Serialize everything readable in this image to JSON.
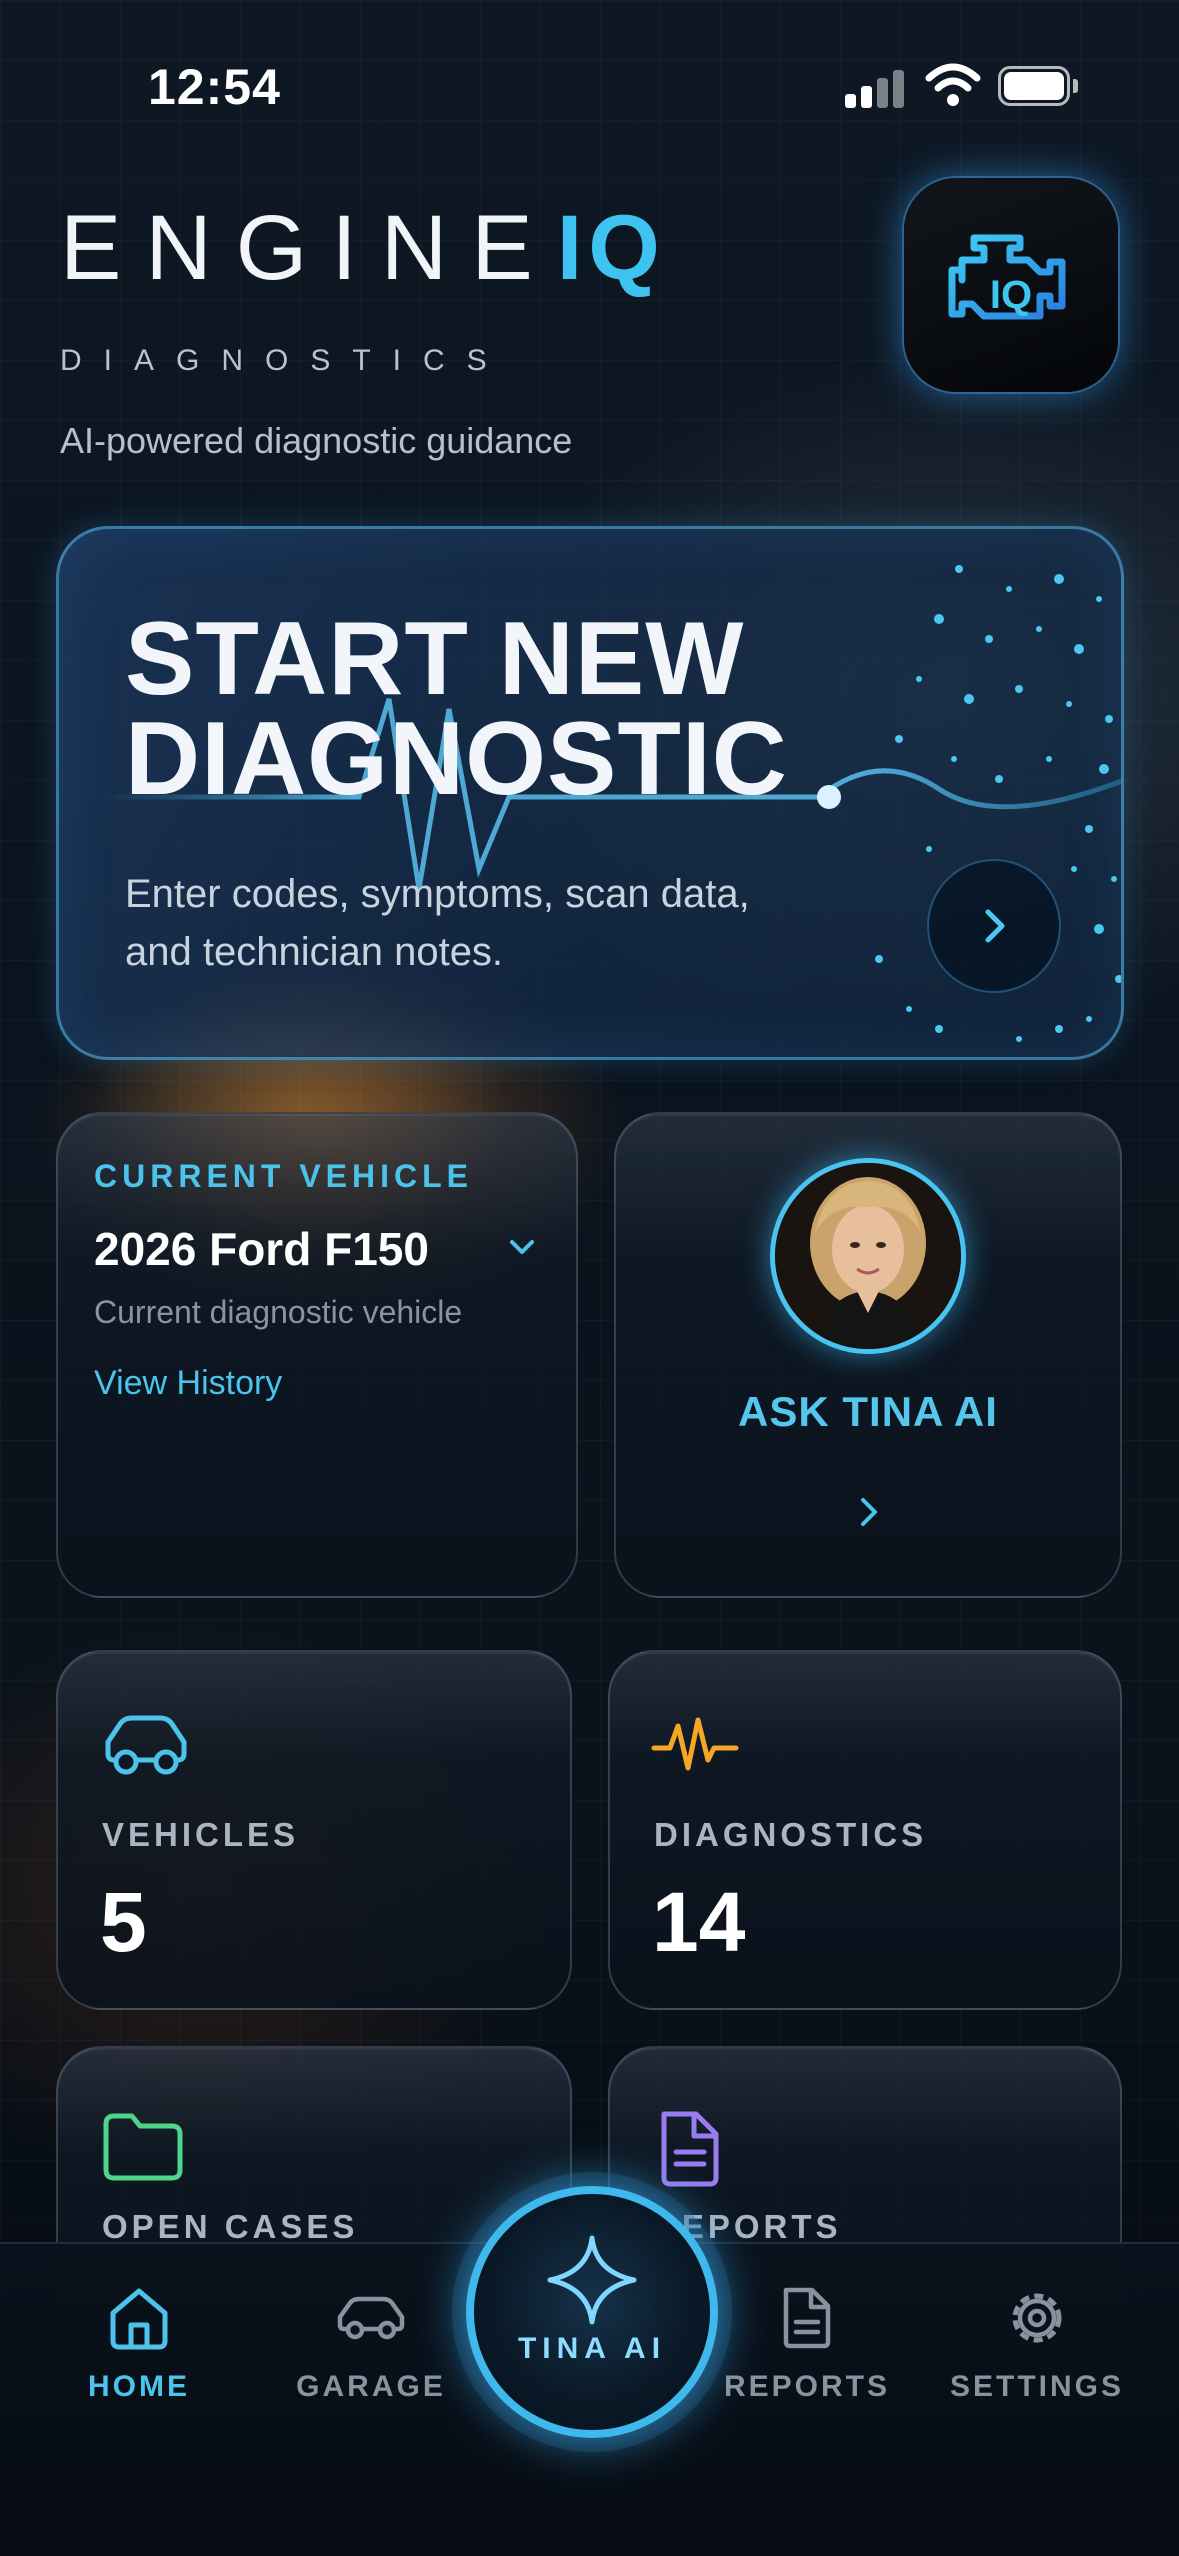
{
  "status_bar": {
    "time": "12:54"
  },
  "header": {
    "brand_main": "ENGINE",
    "brand_accent": "IQ",
    "brand_sub": "DIAGNOSTICS",
    "tagline": "AI-powered diagnostic guidance",
    "app_icon_text": "IQ"
  },
  "hero": {
    "title_line1": "START NEW",
    "title_line2": "DIAGNOSTIC",
    "description": "Enter codes, symptoms, scan data, and technician notes."
  },
  "current_vehicle": {
    "label": "CURRENT VEHICLE",
    "name": "2026 Ford F150",
    "subtitle": "Current diagnostic vehicle",
    "link": "View History"
  },
  "tina": {
    "label": "ASK TINA AI"
  },
  "stats": {
    "vehicles": {
      "label": "VEHICLES",
      "value": "5"
    },
    "diagnostics": {
      "label": "DIAGNOSTICS",
      "value": "14"
    },
    "open_cases": {
      "label": "OPEN CASES"
    },
    "reports": {
      "label": "REPORTS"
    }
  },
  "tabbar": {
    "home": "HOME",
    "garage": "GARAGE",
    "center": "TINA AI",
    "reports": "REPORTS",
    "settings": "SETTINGS"
  },
  "colors": {
    "accent": "#3ec2f0",
    "diagnostics_icon": "#f5a623",
    "cases_icon": "#4fd48b",
    "reports_icon": "#9a7cf0"
  },
  "icons": {
    "hero_button": "chevron-right-icon",
    "vehicle_dropdown": "chevron-down-icon",
    "vehicles": "car-icon",
    "diagnostics": "pulse-icon",
    "open_cases": "folder-icon",
    "reports": "document-icon",
    "home": "home-icon",
    "garage": "car-icon",
    "center": "sparkle-icon",
    "settings": "gear-icon"
  }
}
